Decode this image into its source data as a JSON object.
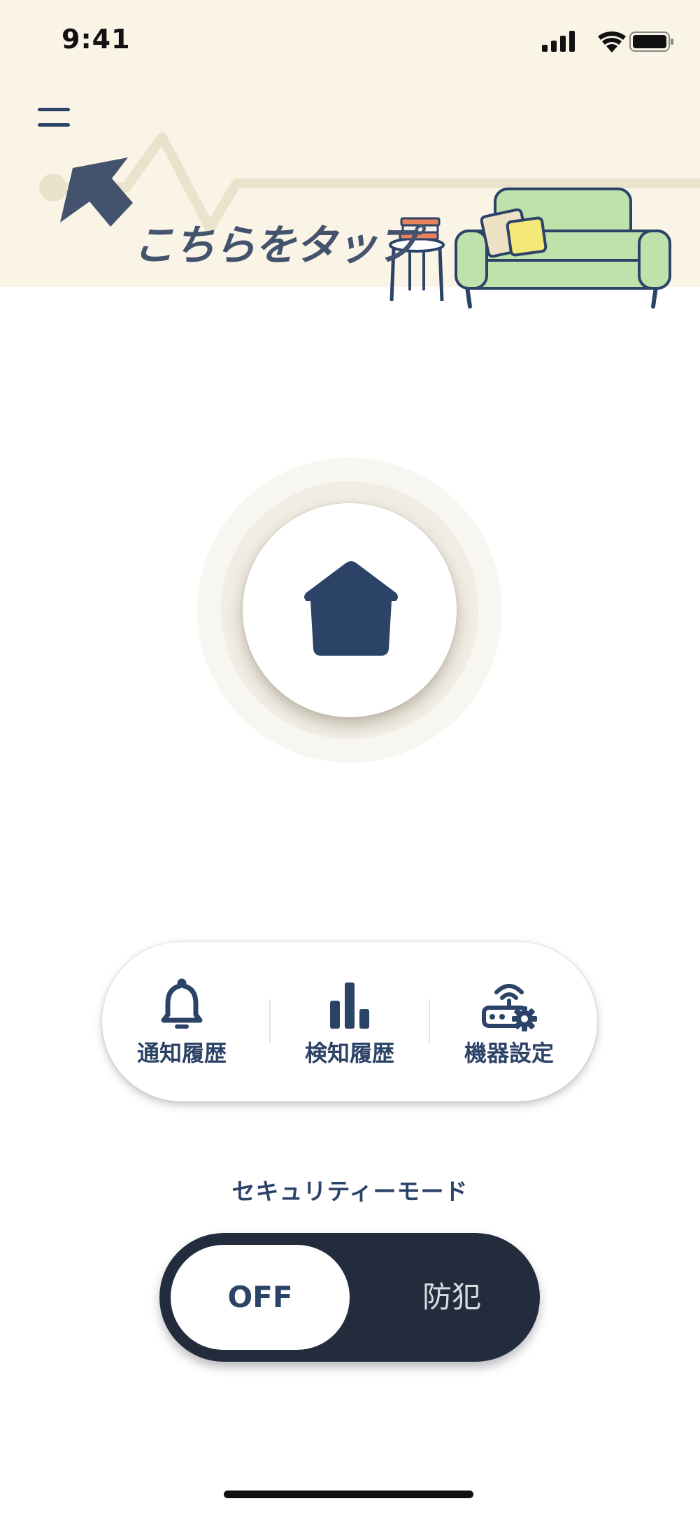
{
  "status_bar": {
    "time": "9:41",
    "icons": [
      "cellular-signal-icon",
      "wifi-icon",
      "battery-icon"
    ]
  },
  "header": {
    "menu_icon": "hamburger-menu-icon",
    "tap_hint": "こちらをタップ",
    "illustration": [
      "pointer-arrow",
      "side-table-with-books",
      "sofa-with-cushions"
    ]
  },
  "home_button": {
    "icon": "house-icon"
  },
  "quick_menu": {
    "items": [
      {
        "label": "通知履歴",
        "icon": "bell-icon"
      },
      {
        "label": "検知履歴",
        "icon": "bar-chart-icon"
      },
      {
        "label": "機器設定",
        "icon": "router-gear-icon"
      }
    ]
  },
  "security_mode": {
    "title": "セキュリティーモード",
    "options": [
      "OFF",
      "防犯"
    ],
    "selected": "OFF"
  },
  "colors": {
    "header_bg": "#faf4e6",
    "navy": "#2c4368",
    "toggle_bg": "#222c3d",
    "sofa_green": "#bfe2ad"
  }
}
